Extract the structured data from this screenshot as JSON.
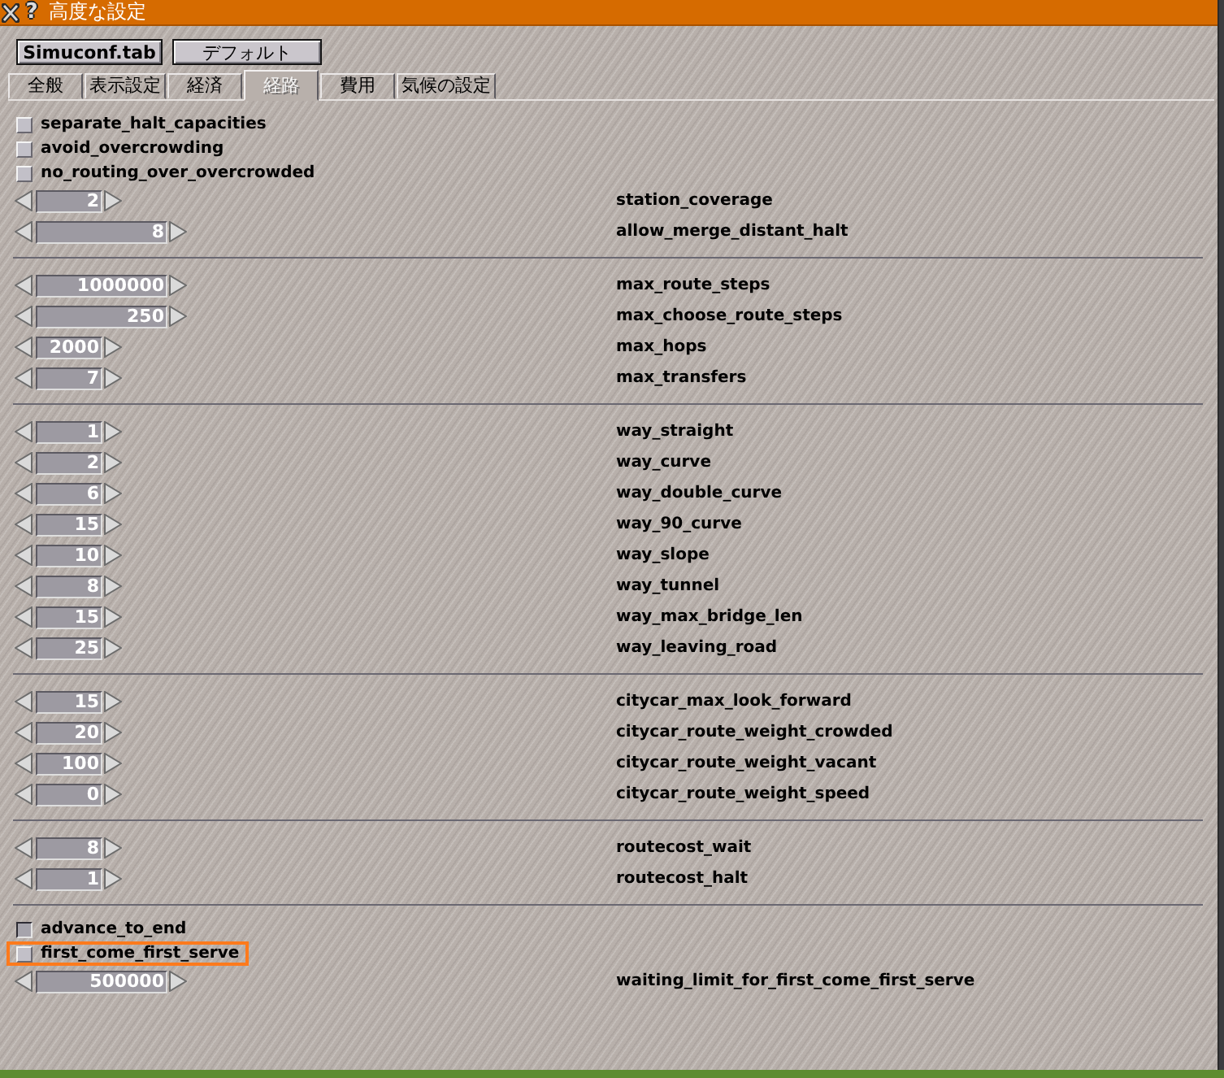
{
  "window": {
    "title": "高度な設定",
    "help_button": "?"
  },
  "buttons": [
    "Simuconf.tab",
    "デフォルト"
  ],
  "tabs": [
    {
      "label": "全般",
      "selected": false
    },
    {
      "label": "表示設定",
      "selected": false
    },
    {
      "label": "経済",
      "selected": false
    },
    {
      "label": "経路",
      "selected": true
    },
    {
      "label": "費用",
      "selected": false
    },
    {
      "label": "気候の設定",
      "selected": false
    }
  ],
  "sections": [
    {
      "checkboxes": [
        {
          "label": "separate_halt_capacities",
          "checked": false,
          "focused": false
        },
        {
          "label": "avoid_overcrowding",
          "checked": false,
          "focused": false
        },
        {
          "label": "no_routing_over_overcrowded",
          "checked": false,
          "focused": false
        }
      ],
      "settings": [
        {
          "kind": "spinner",
          "value": "2",
          "label": "station_coverage",
          "focused": false
        },
        {
          "kind": "long_spinner",
          "value": "8",
          "label": "allow_merge_distant_halt",
          "focused": false
        }
      ]
    },
    {
      "settings": [
        {
          "kind": "long_spinner",
          "value": "1000000",
          "label": "max_route_steps",
          "focused": false
        },
        {
          "kind": "long_spinner",
          "value": "250",
          "label": "max_choose_route_steps",
          "focused": false
        },
        {
          "kind": "spinner",
          "value": "2000",
          "label": "max_hops",
          "focused": false
        },
        {
          "kind": "spinner",
          "value": "7",
          "label": "max_transfers",
          "focused": false
        }
      ]
    },
    {
      "settings": [
        {
          "kind": "spinner",
          "value": "1",
          "label": "way_straight",
          "focused": false
        },
        {
          "kind": "spinner",
          "value": "2",
          "label": "way_curve",
          "focused": false
        },
        {
          "kind": "spinner",
          "value": "6",
          "label": "way_double_curve",
          "focused": false
        },
        {
          "kind": "spinner",
          "value": "15",
          "label": "way_90_curve",
          "focused": false
        },
        {
          "kind": "spinner",
          "value": "10",
          "label": "way_slope",
          "focused": false
        },
        {
          "kind": "spinner",
          "value": "8",
          "label": "way_tunnel",
          "focused": false
        },
        {
          "kind": "spinner",
          "value": "15",
          "label": "way_max_bridge_len",
          "focused": false
        },
        {
          "kind": "spinner",
          "value": "25",
          "label": "way_leaving_road",
          "focused": false
        }
      ]
    },
    {
      "settings": [
        {
          "kind": "spinner",
          "value": "15",
          "label": "citycar_max_look_forward",
          "focused": false
        },
        {
          "kind": "spinner",
          "value": "20",
          "label": "citycar_route_weight_crowded",
          "focused": false
        },
        {
          "kind": "spinner",
          "value": "100",
          "label": "citycar_route_weight_vacant",
          "focused": false
        },
        {
          "kind": "spinner",
          "value": "0",
          "label": "citycar_route_weight_speed",
          "focused": false
        }
      ]
    },
    {
      "settings": [
        {
          "kind": "spinner",
          "value": "8",
          "label": "routecost_wait",
          "focused": false
        },
        {
          "kind": "spinner",
          "value": "1",
          "label": "routecost_halt",
          "focused": false
        }
      ]
    },
    {
      "checkboxes": [
        {
          "label": "advance_to_end",
          "checked": true,
          "focused": false
        },
        {
          "label": "first_come_first_serve",
          "checked": false,
          "focused": true
        }
      ],
      "settings": [
        {
          "kind": "long_spinner",
          "value": "500000",
          "label": "waiting_limit_for_first_come_first_serve",
          "focused": false
        }
      ]
    }
  ]
}
